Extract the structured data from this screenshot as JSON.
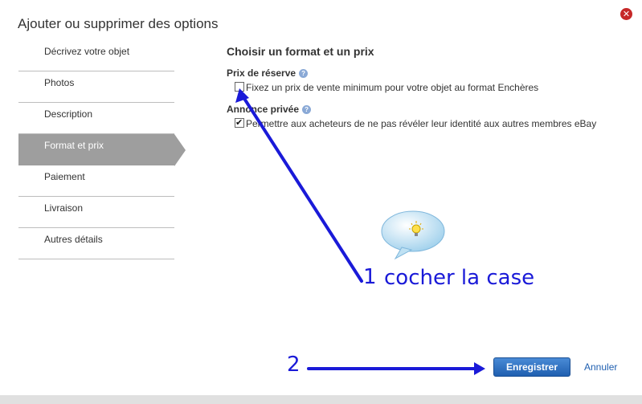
{
  "dialog": {
    "title": "Ajouter ou supprimer des options",
    "close_icon": "close-icon"
  },
  "sidebar": {
    "items": [
      {
        "label": "Décrivez votre objet",
        "active": false
      },
      {
        "label": "Photos",
        "active": false
      },
      {
        "label": "Description",
        "active": false
      },
      {
        "label": "Format et prix",
        "active": true
      },
      {
        "label": "Paiement",
        "active": false
      },
      {
        "label": "Livraison",
        "active": false
      },
      {
        "label": "Autres détails",
        "active": false
      }
    ]
  },
  "main": {
    "title": "Choisir un format et un prix",
    "reserve": {
      "heading": "Prix de réserve",
      "checkbox_label": "Fixez un prix de vente minimum pour votre objet au format Enchères",
      "checked": false
    },
    "private": {
      "heading": "Annonce privée",
      "checkbox_label": "Permettre aux acheteurs de ne pas révéler leur identité aux autres membres eBay",
      "checked": true
    }
  },
  "buttons": {
    "save": "Enregistrer",
    "cancel": "Annuler"
  },
  "annotations": {
    "step1_number": "1",
    "step1_text": "cocher la case",
    "step2_number": "2"
  },
  "colors": {
    "annotation": "#1a1ad8",
    "active_tab": "#9e9e9e",
    "primary_button": "#2f6fc0"
  }
}
